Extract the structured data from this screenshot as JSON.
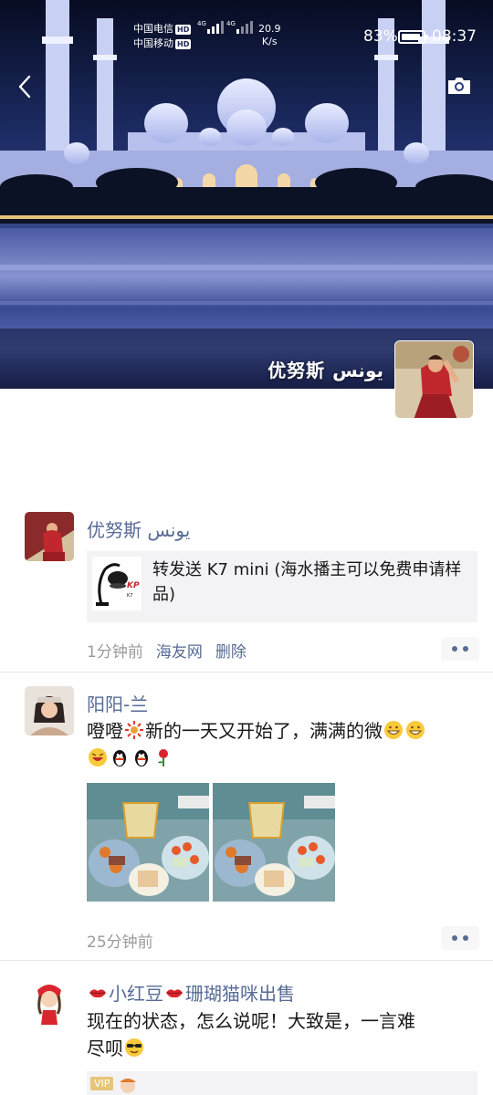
{
  "status_bar": {
    "carrier_1": "中国电信",
    "carrier_2": "中国移动",
    "hd_badge": "HD",
    "network_1": "4G",
    "network_2": "4G",
    "speed_value": "20.9",
    "speed_unit": "K/s",
    "battery_percent": "83%",
    "battery_level": 0.83,
    "time": "08:37"
  },
  "header": {
    "back_icon": "chevron-left-icon",
    "camera_icon": "camera-icon",
    "profile_name": "优努斯 يونس"
  },
  "posts": [
    {
      "author": "优努斯 يونس",
      "share_text": "转发送 K7 mini (海水播主可以免费申请样品)",
      "share_thumb_label": "K7",
      "time": "1分钟前",
      "source": "海友网",
      "delete_label": "删除"
    },
    {
      "author": "阳阳-兰",
      "text_line_1": "噔噔",
      "text_line_1b": "新的一天又开始了，满满的微",
      "time": "25分钟前"
    },
    {
      "author_prefix": "",
      "author": "小红豆",
      "author_suffix": "珊瑚猫咪出售",
      "text_line_1": "现在的状态，怎么说呢！大致是，一言难",
      "text_line_2": "尽呗",
      "card_badge": "VIP"
    }
  ],
  "colors": {
    "link_blue": "#576b95",
    "meta_gray": "#9a9a9a",
    "text": "#181818"
  }
}
